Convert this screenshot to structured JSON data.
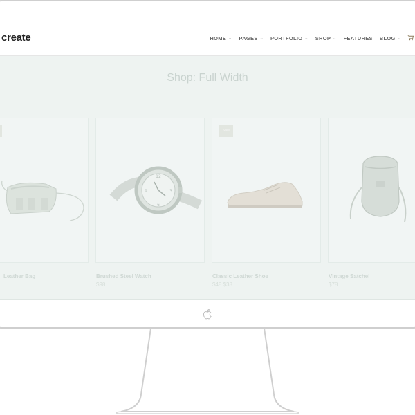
{
  "header": {
    "logo": "create"
  },
  "nav": {
    "items": [
      {
        "label": "HOME"
      },
      {
        "label": "PAGES"
      },
      {
        "label": "PORTFOLIO"
      },
      {
        "label": "SHOP"
      },
      {
        "label": "FEATURES"
      },
      {
        "label": "BLOG"
      }
    ]
  },
  "page": {
    "title": "Shop: Full Width"
  },
  "products": [
    {
      "name": "Leather Bag",
      "price": "",
      "badge": "",
      "icon": "bag-icon"
    },
    {
      "name": "Brushed Steel Watch",
      "price": "$98",
      "badge": "",
      "icon": "watch-icon"
    },
    {
      "name": "Classic Leather Shoe",
      "price": "$48 $38",
      "badge": "Sale",
      "icon": "shoe-icon"
    },
    {
      "name": "Vintage Satchel",
      "price": "$78",
      "badge": "",
      "icon": "satchel-icon"
    }
  ],
  "colors": {
    "screen_bg": "#eef3f1",
    "monitor_border": "#cfcfcf",
    "nav_text": "#666666"
  }
}
